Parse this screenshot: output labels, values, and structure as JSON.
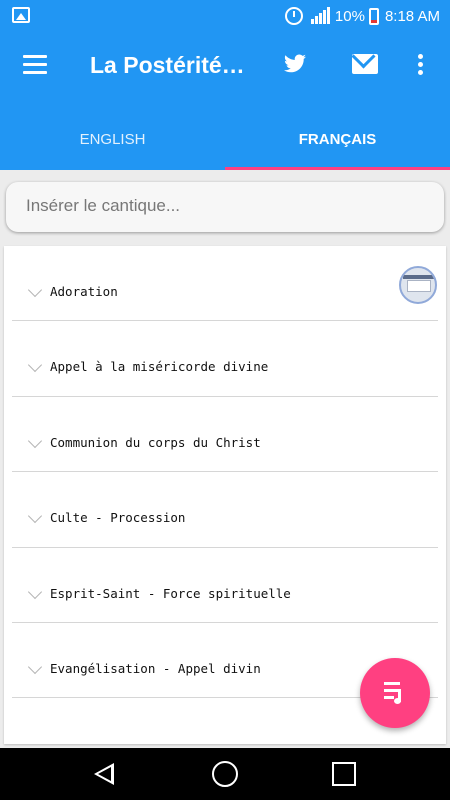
{
  "status_bar": {
    "battery_percent": "10%",
    "time": "8:18 AM",
    "icons": [
      "picture-icon",
      "alarm-icon",
      "signal-icon",
      "battery-icon"
    ]
  },
  "app_bar": {
    "title": "La Postérité…",
    "icons": [
      "menu-icon",
      "twitter-icon",
      "mail-icon",
      "more-icon"
    ],
    "color": "#2196f3"
  },
  "tabs": [
    {
      "label": "ENGLISH",
      "active": false
    },
    {
      "label": "FRANÇAIS",
      "active": true
    }
  ],
  "tab_indicator_color": "#ff4081",
  "search": {
    "placeholder": "Insérer le cantique...",
    "value": ""
  },
  "categories": [
    {
      "label": "Adoration"
    },
    {
      "label": "Appel à la miséricorde divine"
    },
    {
      "label": "Communion du corps du Christ"
    },
    {
      "label": "Culte - Procession"
    },
    {
      "label": "Esprit-Saint - Force spirituelle"
    },
    {
      "label": "Evangélisation - Appel divin"
    },
    {
      "label": ""
    }
  ],
  "fab": {
    "icon": "queue-music-icon",
    "color": "#ff4081"
  },
  "nav_bar": {
    "icons": [
      "back-icon",
      "home-icon",
      "recents-icon"
    ]
  }
}
